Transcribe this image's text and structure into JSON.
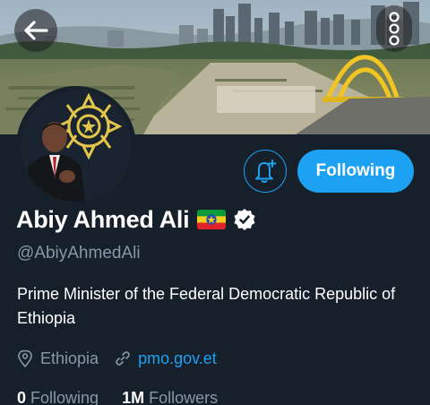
{
  "profile": {
    "name": "Abiy Ahmed Ali",
    "handle": "@AbiyAhmedAli",
    "bio": "Prime Minister of the Federal Democratic Republic of Ethiopia",
    "location": "Ethiopia",
    "website": "pmo.gov.et",
    "verified": true,
    "flag": "ethiopia-flag"
  },
  "actions": {
    "follow_label": "Following",
    "notify_icon": "bell-plus-icon",
    "back_icon": "back-arrow-icon",
    "more_icon": "more-vertical-icon"
  },
  "stats": {
    "following_count": "0",
    "following_label": "Following",
    "followers_count": "1M",
    "followers_label": "Followers"
  },
  "colors": {
    "background": "#15202b",
    "accent": "#1da1f2",
    "muted": "#8899a6"
  }
}
